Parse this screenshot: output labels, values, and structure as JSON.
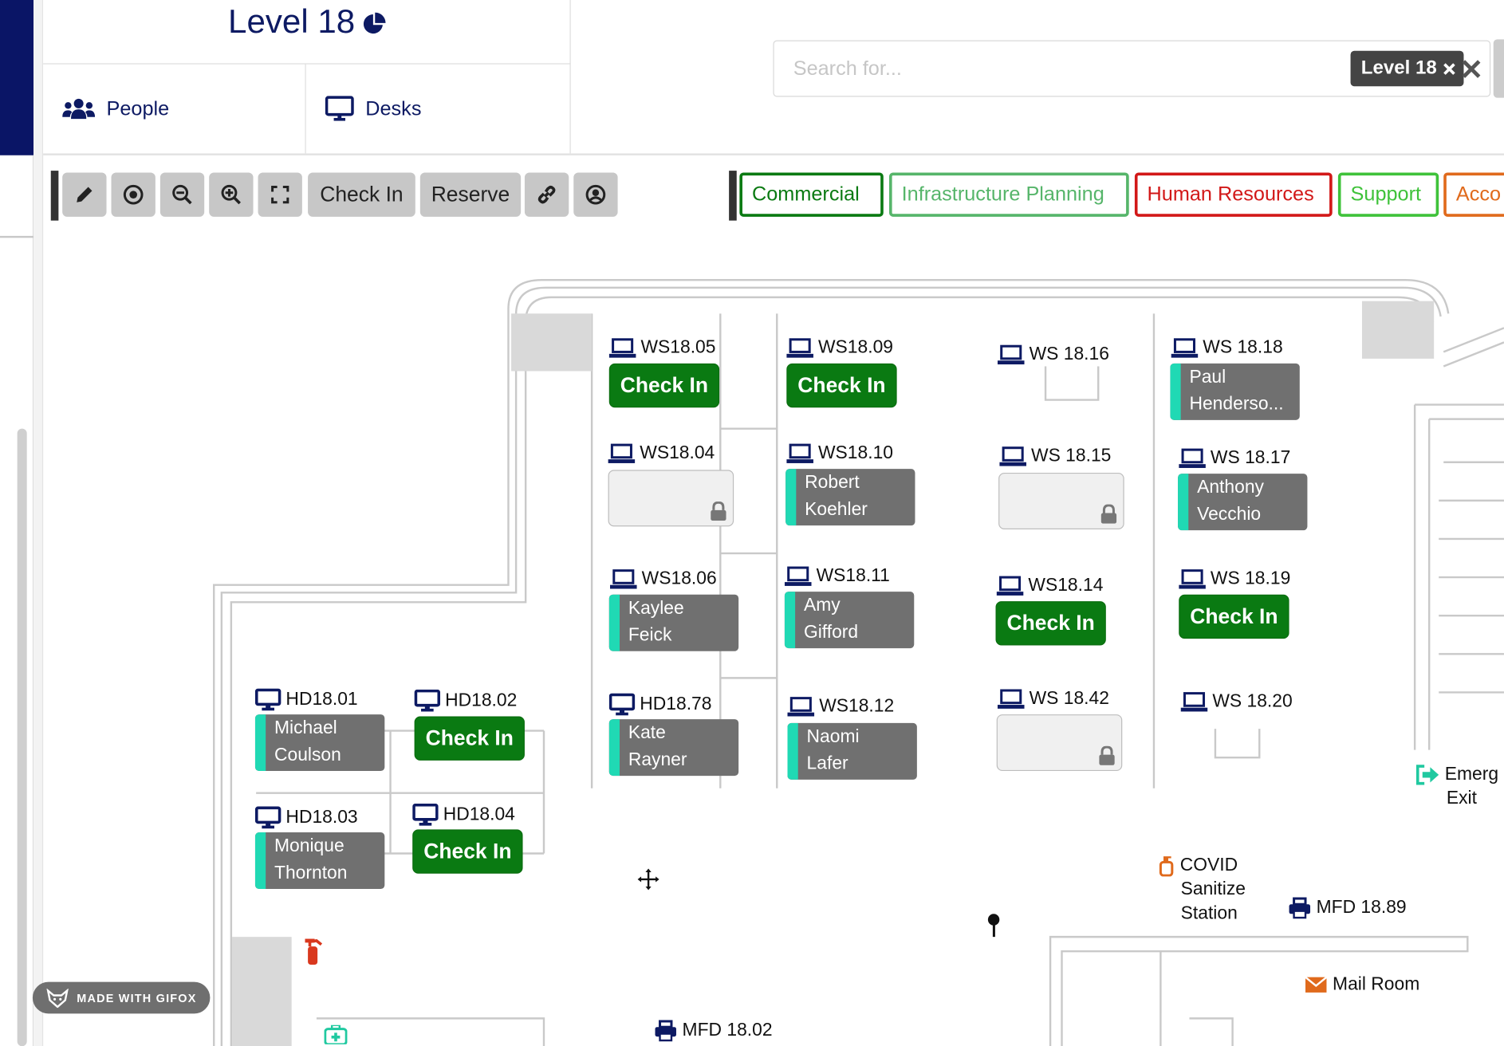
{
  "header": {
    "level_title": "Level 18"
  },
  "tabs": {
    "people": "People",
    "desks": "Desks"
  },
  "search": {
    "placeholder": "Search for...",
    "chip": "Level 18"
  },
  "toolbar": {
    "checkin": "Check In",
    "reserve": "Reserve"
  },
  "filters": [
    {
      "label": "Commercial",
      "color": "#0a7a12"
    },
    {
      "label": "Infrastructure Planning",
      "color": "#56b56a"
    },
    {
      "label": "Human Resources",
      "color": "#d21818"
    },
    {
      "label": "Support",
      "color": "#3fc23a"
    },
    {
      "label": "Acco",
      "color": "#e06a1c"
    }
  ],
  "desks": {
    "ws1805": {
      "label": "WS18.05",
      "state": "Check In"
    },
    "ws1809": {
      "label": "WS18.09",
      "state": "Check In"
    },
    "ws1816": {
      "label": "WS 18.16"
    },
    "ws1818": {
      "label": "WS 18.18",
      "occupant_1": "Paul",
      "occupant_2": "Henderso..."
    },
    "ws1804": {
      "label": "WS18.04"
    },
    "ws1810": {
      "label": "WS18.10",
      "occupant_1": "Robert",
      "occupant_2": "Koehler"
    },
    "ws1815": {
      "label": "WS 18.15"
    },
    "ws1817": {
      "label": "WS 18.17",
      "occupant_1": "Anthony",
      "occupant_2": "Vecchio"
    },
    "ws1806": {
      "label": "WS18.06",
      "occupant_1": "Kaylee",
      "occupant_2": "Feick"
    },
    "ws1811": {
      "label": "WS18.11",
      "occupant_1": "Amy",
      "occupant_2": "Gifford"
    },
    "ws1814": {
      "label": "WS18.14",
      "state": "Check In"
    },
    "ws1819": {
      "label": "WS 18.19",
      "state": "Check In"
    },
    "hd1801": {
      "label": "HD18.01",
      "occupant_1": "Michael",
      "occupant_2": "Coulson"
    },
    "hd1802": {
      "label": "HD18.02",
      "state": "Check In"
    },
    "hd1878": {
      "label": "HD18.78",
      "occupant_1": "Kate",
      "occupant_2": "Rayner"
    },
    "ws1812": {
      "label": "WS18.12",
      "occupant_1": "Naomi",
      "occupant_2": "Lafer"
    },
    "ws1842": {
      "label": "WS 18.42"
    },
    "ws1820": {
      "label": "WS 18.20"
    },
    "hd1803": {
      "label": "HD18.03",
      "occupant_1": "Monique",
      "occupant_2": "Thornton"
    },
    "hd1804": {
      "label": "HD18.04",
      "state": "Check In"
    }
  },
  "poi": {
    "emergency_1": "Emerg",
    "emergency_2": "Exit",
    "covid_1": "COVID",
    "covid_2": "Sanitize",
    "covid_3": "Station",
    "mfd1889": "MFD 18.89",
    "mailroom": "Mail Room",
    "mfd1802": "MFD 18.02"
  },
  "watermark": "MADE WITH GIFOX",
  "colors": {
    "navy": "#0a1566",
    "green": "#0a7a12",
    "occupied": "#707070",
    "accent": "#20d9b4"
  }
}
